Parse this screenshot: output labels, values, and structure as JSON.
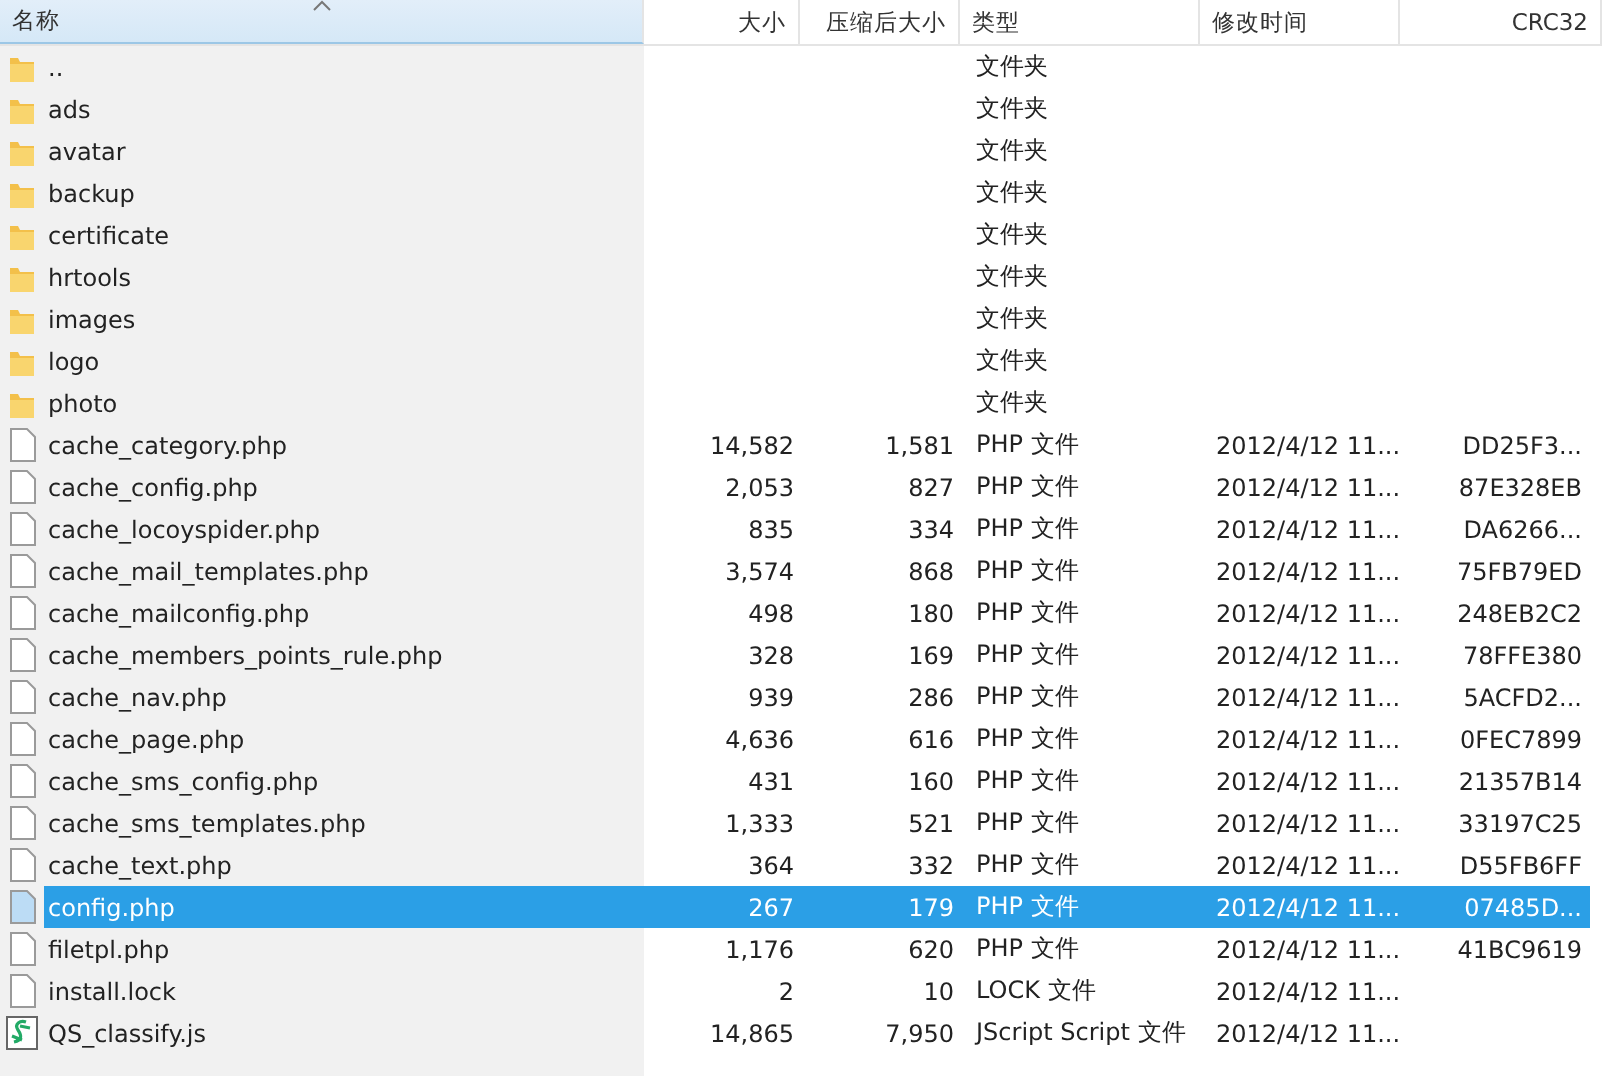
{
  "table": {
    "columns": [
      {
        "label": "名称",
        "sorted": true
      },
      {
        "label": "大小",
        "sorted": false
      },
      {
        "label": "压缩后大小",
        "sorted": false
      },
      {
        "label": "类型",
        "sorted": false
      },
      {
        "label": "修改时间",
        "sorted": false
      },
      {
        "label": "CRC32",
        "sorted": false
      }
    ],
    "rows": [
      {
        "kind": "folder",
        "name": "..",
        "type": "文件夹",
        "selected": false
      },
      {
        "kind": "folder",
        "name": "ads",
        "type": "文件夹",
        "selected": false
      },
      {
        "kind": "folder",
        "name": "avatar",
        "type": "文件夹",
        "selected": false
      },
      {
        "kind": "folder",
        "name": "backup",
        "type": "文件夹",
        "selected": false
      },
      {
        "kind": "folder",
        "name": "certificate",
        "type": "文件夹",
        "selected": false
      },
      {
        "kind": "folder",
        "name": "hrtools",
        "type": "文件夹",
        "selected": false
      },
      {
        "kind": "folder",
        "name": "images",
        "type": "文件夹",
        "selected": false
      },
      {
        "kind": "folder",
        "name": "logo",
        "type": "文件夹",
        "selected": false
      },
      {
        "kind": "folder",
        "name": "photo",
        "type": "文件夹",
        "selected": false
      },
      {
        "kind": "file",
        "name": "cache_category.php",
        "size": "14,582",
        "packed": "1,581",
        "type": "PHP 文件",
        "modified": "2012/4/12 11...",
        "crc": "DD25F3...",
        "selected": false
      },
      {
        "kind": "file",
        "name": "cache_config.php",
        "size": "2,053",
        "packed": "827",
        "type": "PHP 文件",
        "modified": "2012/4/12 11...",
        "crc": "87E328EB",
        "selected": false
      },
      {
        "kind": "file",
        "name": "cache_locoyspider.php",
        "size": "835",
        "packed": "334",
        "type": "PHP 文件",
        "modified": "2012/4/12 11...",
        "crc": "DA6266...",
        "selected": false
      },
      {
        "kind": "file",
        "name": "cache_mail_templates.php",
        "size": "3,574",
        "packed": "868",
        "type": "PHP 文件",
        "modified": "2012/4/12 11...",
        "crc": "75FB79ED",
        "selected": false
      },
      {
        "kind": "file",
        "name": "cache_mailconfig.php",
        "size": "498",
        "packed": "180",
        "type": "PHP 文件",
        "modified": "2012/4/12 11...",
        "crc": "248EB2C2",
        "selected": false
      },
      {
        "kind": "file",
        "name": "cache_members_points_rule.php",
        "size": "328",
        "packed": "169",
        "type": "PHP 文件",
        "modified": "2012/4/12 11...",
        "crc": "78FFE380",
        "selected": false
      },
      {
        "kind": "file",
        "name": "cache_nav.php",
        "size": "939",
        "packed": "286",
        "type": "PHP 文件",
        "modified": "2012/4/12 11...",
        "crc": "5ACFD2...",
        "selected": false
      },
      {
        "kind": "file",
        "name": "cache_page.php",
        "size": "4,636",
        "packed": "616",
        "type": "PHP 文件",
        "modified": "2012/4/12 11...",
        "crc": "0FEC7899",
        "selected": false
      },
      {
        "kind": "file",
        "name": "cache_sms_config.php",
        "size": "431",
        "packed": "160",
        "type": "PHP 文件",
        "modified": "2012/4/12 11...",
        "crc": "21357B14",
        "selected": false
      },
      {
        "kind": "file",
        "name": "cache_sms_templates.php",
        "size": "1,333",
        "packed": "521",
        "type": "PHP 文件",
        "modified": "2012/4/12 11...",
        "crc": "33197C25",
        "selected": false
      },
      {
        "kind": "file",
        "name": "cache_text.php",
        "size": "364",
        "packed": "332",
        "type": "PHP 文件",
        "modified": "2012/4/12 11...",
        "crc": "D55FB6FF",
        "selected": false
      },
      {
        "kind": "file",
        "name": "config.php",
        "size": "267",
        "packed": "179",
        "type": "PHP 文件",
        "modified": "2012/4/12 11...",
        "crc": "07485D...",
        "selected": true
      },
      {
        "kind": "file",
        "name": "filetpl.php",
        "size": "1,176",
        "packed": "620",
        "type": "PHP 文件",
        "modified": "2012/4/12 11...",
        "crc": "41BC9619",
        "selected": false
      },
      {
        "kind": "file",
        "name": "install.lock",
        "size": "2",
        "packed": "10",
        "type": "LOCK 文件",
        "modified": "2012/4/12 11...",
        "selected": false
      },
      {
        "kind": "script",
        "name": "QS_classify.js",
        "size": "14,865",
        "packed": "7,950",
        "type": "JScript Script 文件",
        "modified": "2012/4/12 11...",
        "selected": false
      }
    ]
  }
}
